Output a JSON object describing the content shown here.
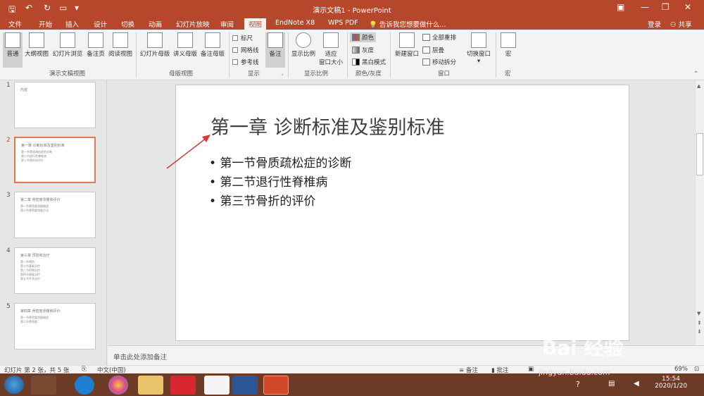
{
  "titlebar": {
    "title": "演示文稿1 - PowerPoint",
    "login": "登录"
  },
  "tabs": [
    "文件",
    "开始",
    "插入",
    "设计",
    "切换",
    "动画",
    "幻灯片放映",
    "审阅",
    "视图",
    "EndNote X8",
    "WPS PDF"
  ],
  "active_tab": "视图",
  "tell_me": "告诉我您想要做什么...",
  "share": "共享",
  "ribbon": {
    "presentation_views": {
      "group": "演示文稿视图",
      "buttons": [
        "普通",
        "大纲视图",
        "幻灯片浏览",
        "备注页",
        "阅读视图"
      ]
    },
    "master_views": {
      "group": "母版视图",
      "buttons": [
        "幻灯片母版",
        "讲义母版",
        "备注母版"
      ]
    },
    "show": {
      "group": "显示",
      "checkboxes": [
        "标尺",
        "网格线",
        "参考线"
      ],
      "notes_button": "备注"
    },
    "zoom": {
      "group": "显示比例",
      "buttons": [
        "显示比例",
        "适应\n窗口大小"
      ],
      "btn2_line1": "适应",
      "btn2_line2": "窗口大小"
    },
    "color": {
      "group": "颜色/灰度",
      "options": [
        "颜色",
        "灰度",
        "黑白模式"
      ]
    },
    "window": {
      "group": "窗口",
      "new_window": "新建窗口",
      "options": [
        "全部重排",
        "层叠",
        "移动拆分"
      ],
      "switch": "切换窗口"
    },
    "macro": {
      "group": "宏",
      "button": "宏"
    }
  },
  "thumbnails": [
    {
      "num": "1",
      "title": "内容",
      "lines": []
    },
    {
      "num": "2",
      "title": "第一章 诊断标准及鉴别标准",
      "lines": [
        "第一节骨质疏松症的诊断",
        "第二节退行性脊椎病",
        "第三节骨折的评价"
      ]
    },
    {
      "num": "3",
      "title": "第二章 骨密度测量和评价",
      "lines": [
        "第一节骨密度测量概述",
        "第二节骨密度测量方法"
      ]
    },
    {
      "num": "4",
      "title": "第三章 预防和治疗",
      "lines": [
        "第一节预防",
        "第二节基础治疗",
        "第三节药物治疗",
        "第四节康复治疗",
        "第五节手术治疗"
      ]
    },
    {
      "num": "5",
      "title": "第四章 骨密度测量和评价",
      "lines": [
        "第一节骨密度测量概述",
        "第二节骨密度"
      ]
    }
  ],
  "slide": {
    "title": "第一章 诊断标准及鉴别标准",
    "bullets": [
      "第一节骨质疏松症的诊断",
      "第二节退行性脊椎病",
      "第三节骨折的评价"
    ]
  },
  "notes_placeholder": "单击此处添加备注",
  "status": {
    "slide_info": "幻灯片 第 2 张，共 5 张",
    "language": "中文(中国)",
    "notes": "备注",
    "comments": "批注",
    "zoom": "69%"
  },
  "taskbar": {
    "time": "15:54",
    "date": "2020/1/20"
  },
  "watermark": {
    "text": "Bai 经验",
    "url": "jingyan.baidu.com"
  },
  "colors": {
    "accent": "#b7472a",
    "selected_thumb": "#e0794f",
    "annotation_arrow": "#d9363e"
  }
}
